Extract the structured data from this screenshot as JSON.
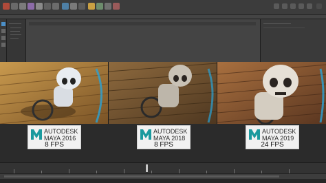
{
  "app": {
    "toolbar_icons": [
      "menu-icon",
      "select-icon",
      "lasso-icon",
      "paint-icon",
      "move-icon",
      "rotate-icon",
      "scale-icon",
      "snap-grid-icon",
      "snap-curve-icon",
      "snap-point-icon",
      "render-icon",
      "ipr-icon",
      "settings-icon",
      "hypershade-icon"
    ],
    "right_toolbar_icons": [
      "workspace-icon",
      "panel-layout-icon",
      "attribute-toggle-icon",
      "tool-settings-icon",
      "channel-box-icon",
      "close-icon"
    ]
  },
  "comparison": {
    "panels": [
      {
        "brand": "AUTODESK",
        "product": "MAYA",
        "version": "2016",
        "fps": "8 FPS",
        "logo_color": "#1a9a9e",
        "floor_color": "#a97a38",
        "character_color": "#d9dde3"
      },
      {
        "brand": "AUTODESK",
        "product": "MAYA",
        "version": "2018",
        "fps": "8 FPS",
        "logo_color": "#1a9a9e",
        "floor_color": "#7a5a34",
        "character_color": "#c9c2b6"
      },
      {
        "brand": "AUTODESK",
        "product": "MAYA",
        "version": "2019",
        "fps": "24 FPS",
        "logo_color": "#1a9a9e",
        "floor_color": "#8c5a36",
        "character_color": "#e6e0d6"
      }
    ]
  },
  "colors": {
    "maya_teal": "#1a9a9e",
    "ui_dark": "#2b2b2b",
    "badge_bg": "#f1f1f1"
  }
}
